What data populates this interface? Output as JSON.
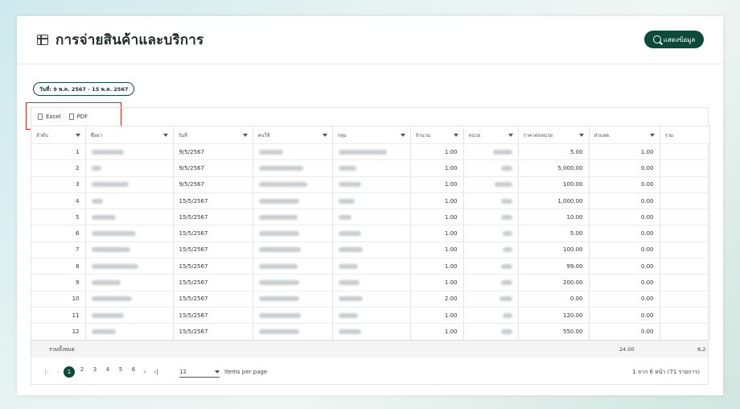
{
  "header": {
    "title": "การจ่ายสินค้าและบริการ",
    "show_button": "แสดงข้อมูล"
  },
  "filter": {
    "date_range": "วันที่: 9 พ.ค. 2567 - 15 พ.ค. 2567"
  },
  "toolbar": {
    "excel": "Excel",
    "pdf": "PDF"
  },
  "table": {
    "columns": [
      "ลำดับ",
      "ชื่อยา",
      "วันที่",
      "คนใช้",
      "กลุ่ม",
      "จำนวน",
      "หน่วย",
      "ราคาต่อหน่วย",
      "ส่วนลด",
      "รวม"
    ],
    "rows": [
      {
        "no": "1",
        "date": "9/5/2567",
        "qty": "1.00",
        "price": "5.00",
        "discount": "1.00"
      },
      {
        "no": "2",
        "date": "9/5/2567",
        "qty": "1.00",
        "price": "5,000.00",
        "discount": "0.00"
      },
      {
        "no": "3",
        "date": "9/5/2567",
        "qty": "1.00",
        "price": "100.00",
        "discount": "0.00"
      },
      {
        "no": "4",
        "date": "15/5/2567",
        "qty": "1.00",
        "price": "1,000.00",
        "discount": "0.00"
      },
      {
        "no": "5",
        "date": "15/5/2567",
        "qty": "1.00",
        "price": "10.00",
        "discount": "0.00"
      },
      {
        "no": "6",
        "date": "15/5/2567",
        "qty": "1.00",
        "price": "5.00",
        "discount": "0.00"
      },
      {
        "no": "7",
        "date": "15/5/2567",
        "qty": "1.00",
        "price": "100.00",
        "discount": "0.00"
      },
      {
        "no": "8",
        "date": "15/5/2567",
        "qty": "1.00",
        "price": "99.00",
        "discount": "0.00"
      },
      {
        "no": "9",
        "date": "15/5/2567",
        "qty": "1.00",
        "price": "200.00",
        "discount": "0.00"
      },
      {
        "no": "10",
        "date": "15/5/2567",
        "qty": "2.00",
        "price": "0.00",
        "discount": "0.00"
      },
      {
        "no": "11",
        "date": "15/5/2567",
        "qty": "1.00",
        "price": "120.00",
        "discount": "0.00"
      },
      {
        "no": "12",
        "date": "15/5/2567",
        "qty": "1.00",
        "price": "550.00",
        "discount": "0.00"
      }
    ],
    "total_label": "รวมทั้งหมด",
    "total_discount": "24.00",
    "total_sum": "8,2"
  },
  "pager": {
    "pages": [
      "1",
      "2",
      "3",
      "4",
      "5",
      "6"
    ],
    "page_size": "12",
    "per_page_label": "Items per page",
    "range_text": "1 จาก 6 หน้า (71 รายการ)"
  },
  "colors": {
    "accent": "#0c4a3c",
    "highlight": "#e0251d"
  }
}
